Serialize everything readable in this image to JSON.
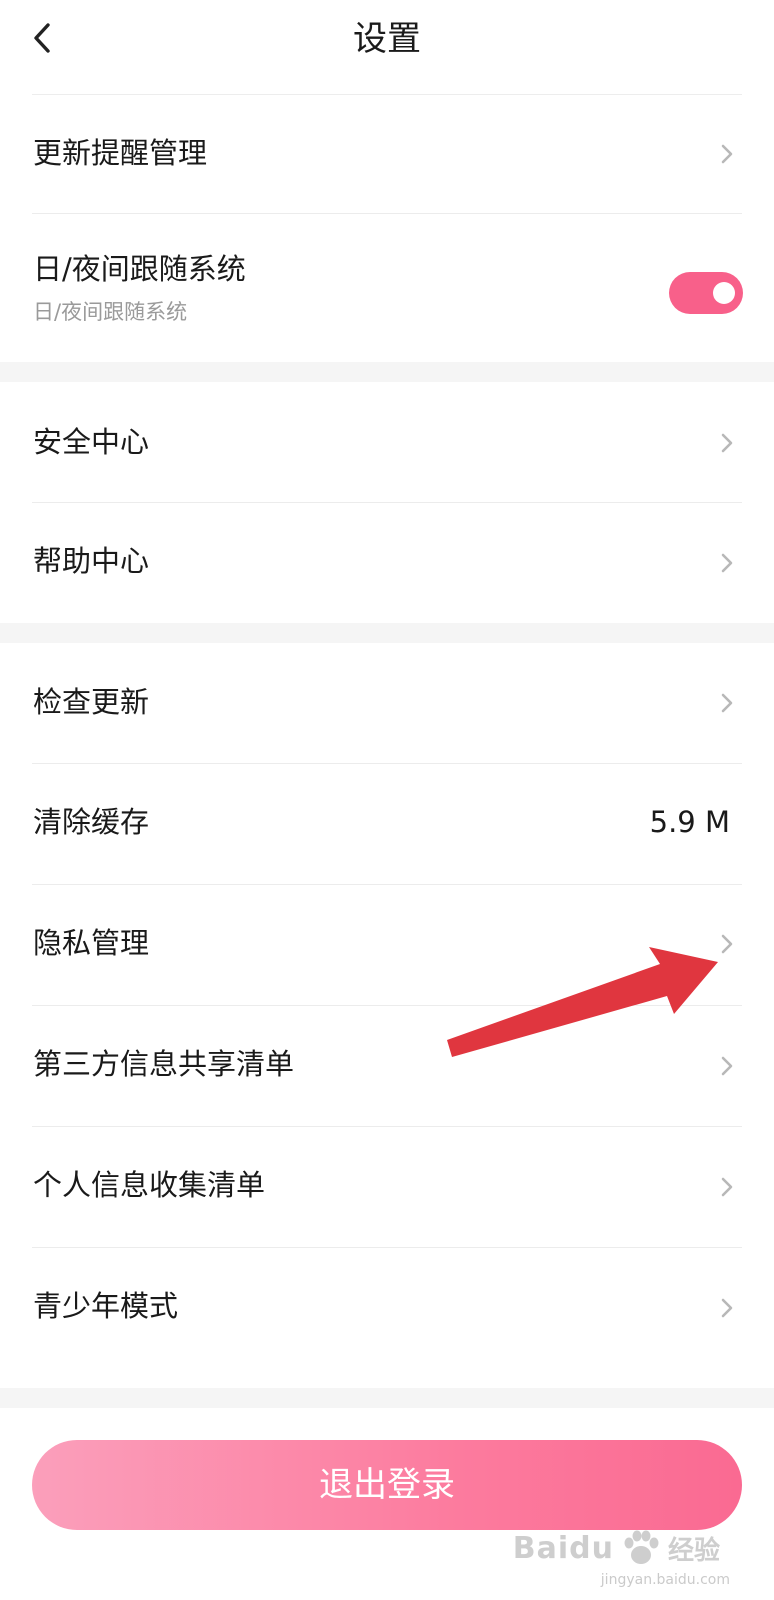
{
  "header": {
    "back_icon": "chevron-left-icon",
    "title": "设置"
  },
  "section1": {
    "update_reminder": {
      "label": "更新提醒管理",
      "icon": "chevron-right-icon"
    },
    "day_night": {
      "label": "日/夜间跟随系统",
      "subtitle": "日/夜间跟随系统",
      "toggle_on": true,
      "toggle_color": "#f8608a"
    }
  },
  "section2": {
    "items": [
      {
        "label": "安全中心",
        "icon": "chevron-right-icon"
      },
      {
        "label": "帮助中心",
        "icon": "chevron-right-icon"
      }
    ]
  },
  "section3": {
    "check_update": {
      "label": "检查更新",
      "icon": "chevron-right-icon"
    },
    "clear_cache": {
      "label": "清除缓存",
      "value": "5.9 M"
    },
    "privacy": {
      "label": "隐私管理",
      "icon": "chevron-right-icon"
    },
    "third_party": {
      "label": "第三方信息共享清单",
      "icon": "chevron-right-icon"
    },
    "personal_info": {
      "label": "个人信息收集清单",
      "icon": "chevron-right-icon"
    },
    "teen_mode": {
      "label": "青少年模式",
      "icon": "chevron-right-icon"
    }
  },
  "logout": {
    "label": "退出登录"
  },
  "annotation": {
    "icon": "red-arrow-icon",
    "color": "#e0363f"
  },
  "watermark": {
    "brand": "Baidu",
    "cn": "经验",
    "url": "jingyan.baidu.com"
  },
  "colors": {
    "accent": "#f8608a",
    "gap_background": "#f5f5f5",
    "chevron": "#b8b8b8",
    "subtitle": "#9a9a9a"
  }
}
